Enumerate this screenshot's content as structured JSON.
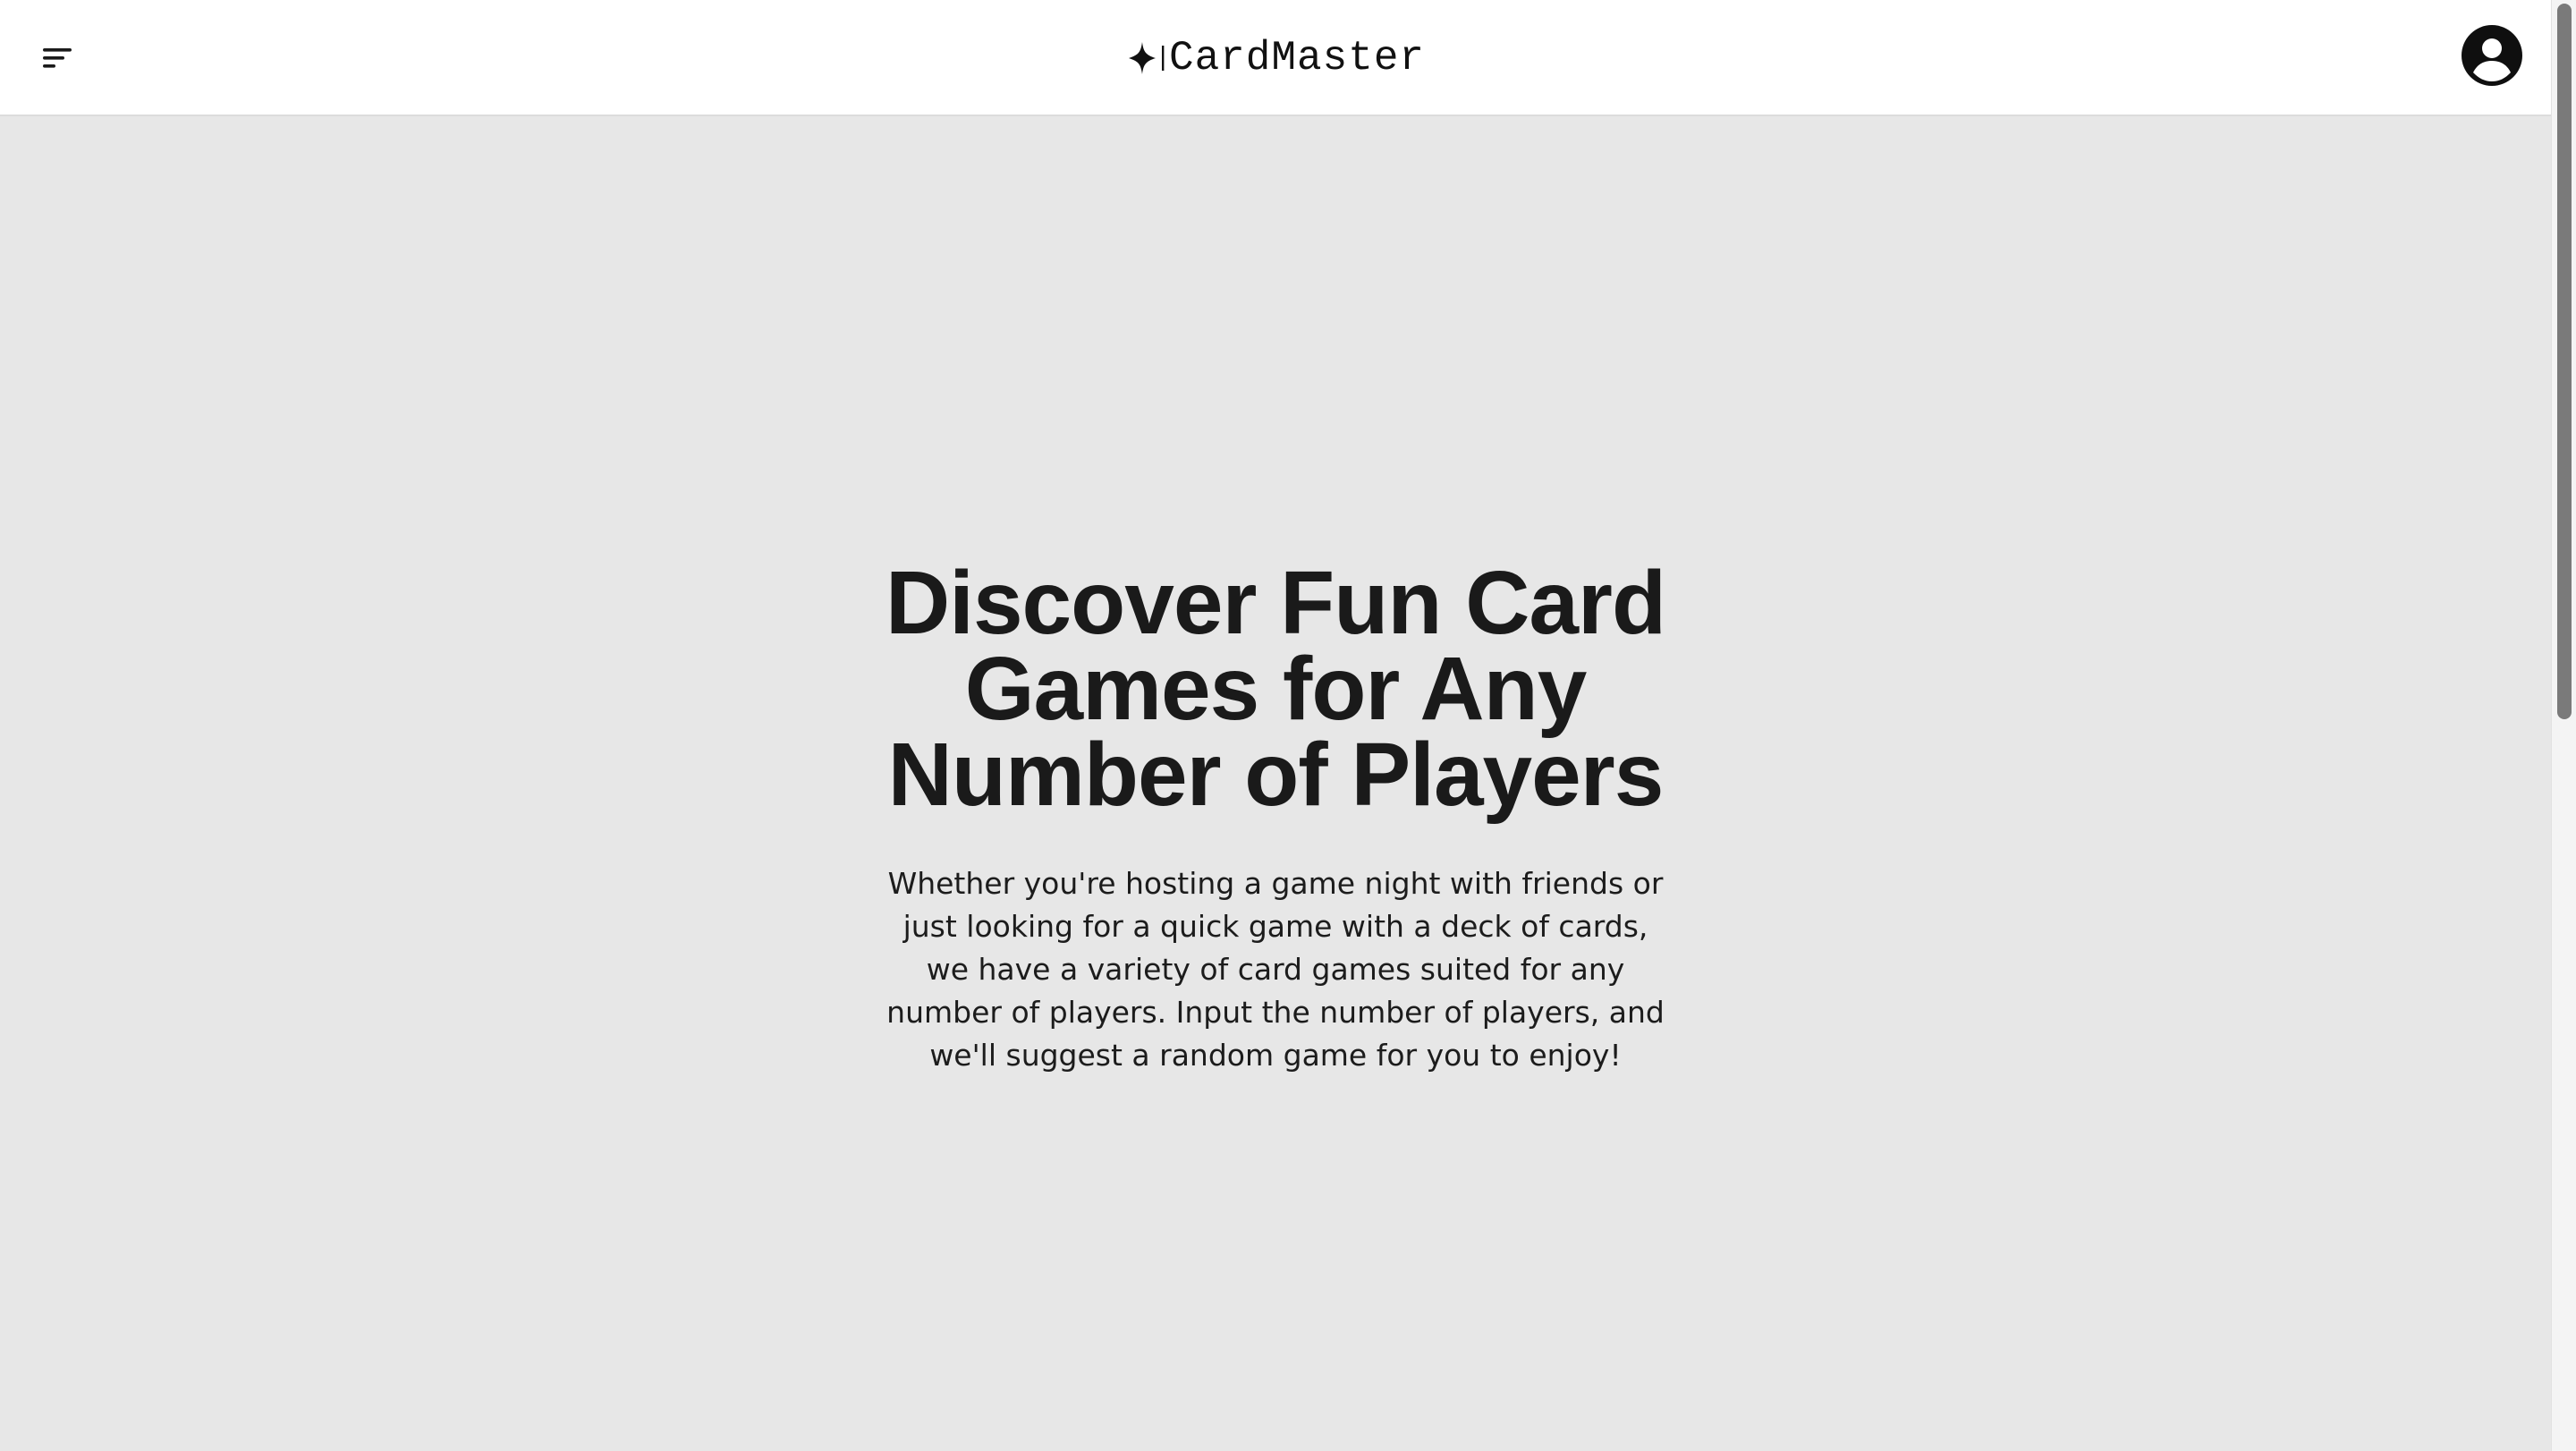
{
  "header": {
    "logo_text": "CardMaster",
    "menu_icon": "hamburger-menu-icon",
    "logo_icon": "sparkle-icon",
    "account_icon": "user-circle-icon"
  },
  "hero": {
    "title": "Discover Fun Card Games for Any Number of Players",
    "description": "Whether you're hosting a game night with friends or just looking for a quick game with a deck of cards, we have a variety of card games suited for any number of players. Input the number of players, and we'll suggest a random game for you to enjoy!"
  },
  "colors": {
    "header_bg": "#ffffff",
    "main_bg": "#e7e7e7",
    "text": "#1a1a1a"
  }
}
